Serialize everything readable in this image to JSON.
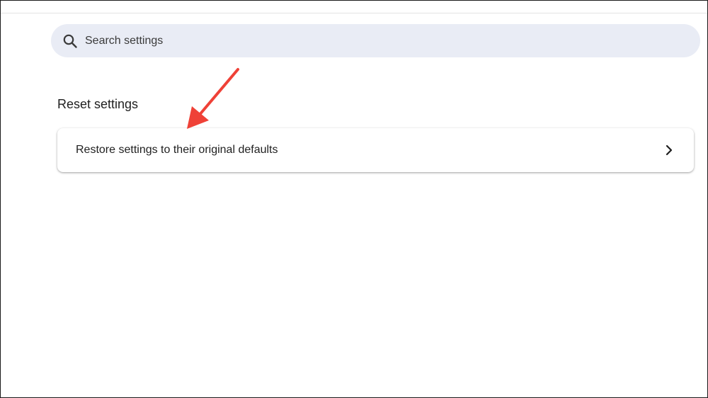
{
  "search": {
    "placeholder": "Search settings",
    "icon": "search-icon"
  },
  "section": {
    "title": "Reset settings"
  },
  "reset_card": {
    "label": "Restore settings to their original defaults",
    "icon": "chevron-right-icon"
  },
  "colors": {
    "search_bg": "#e9ecf5",
    "arrow": "#ef4137",
    "text": "#1f1f1f"
  }
}
